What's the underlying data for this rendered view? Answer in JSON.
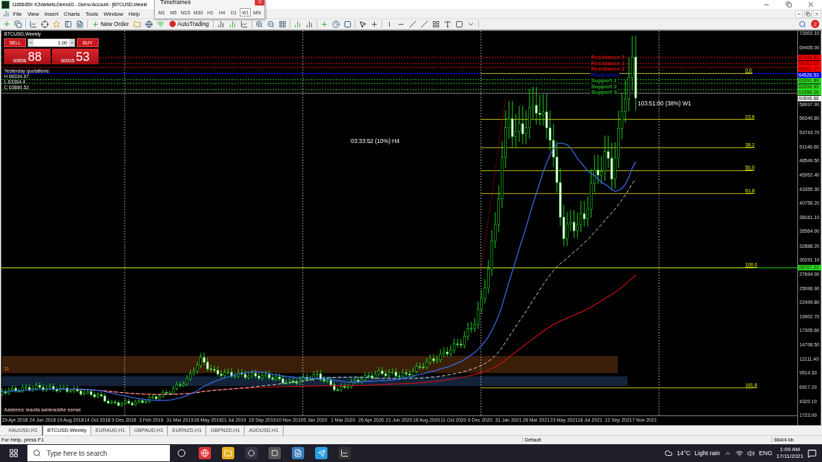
{
  "window": {
    "title": "11656359: ICMarkets-Demo01 - Demo Account - [BTCUSD,Weekl"
  },
  "timeframes_popup": {
    "title": "Timeframes",
    "buttons": [
      {
        "label": "M1",
        "selected": false
      },
      {
        "label": "M5",
        "selected": false
      },
      {
        "label": "M15",
        "selected": false
      },
      {
        "label": "M30",
        "selected": false
      },
      {
        "label": "H1",
        "selected": false
      },
      {
        "label": "H4",
        "selected": false
      },
      {
        "label": "D1",
        "selected": false
      },
      {
        "label": "W1",
        "selected": true
      },
      {
        "label": "MN",
        "selected": false
      }
    ]
  },
  "menu": [
    "File",
    "View",
    "Insert",
    "Charts",
    "Tools",
    "Window",
    "Help"
  ],
  "toolbar": {
    "new_order": "New Order",
    "auto_trading": "AutoTrading",
    "notifications": "2"
  },
  "chart": {
    "title": "BTCUSD,Weekly",
    "trade_panel": {
      "sell": "SELL",
      "buy": "BUY",
      "lot": "1.00",
      "sell_small": "60896",
      "sell_big": "88",
      "buy_small": "60915",
      "buy_big": "53"
    },
    "quotations": [
      "Yesterday quotations:",
      "H 66334.67",
      "L 63364.4",
      "C 63880.52"
    ],
    "pivots": [
      {
        "label": "Resistance 3",
        "color": "#e01010"
      },
      {
        "label": "Resistance 2",
        "color": "#e01010"
      },
      {
        "label": "Resistance 1",
        "color": "#e01010"
      },
      {
        "label": "Pivot level",
        "color": "#1010d0"
      },
      {
        "label": "Support 1",
        "color": "#20b020"
      },
      {
        "label": "Support 2",
        "color": "#20b020"
      },
      {
        "label": "Support 3",
        "color": "#20b020"
      }
    ],
    "fib_levels": [
      "0.0",
      "23.6",
      "38.2",
      "50.0",
      "61.8",
      "100.0",
      "161.8"
    ],
    "timers": [
      "03:33:52 (10%) H4",
      "103:51:00 (38%) W1"
    ],
    "marker_text": "11",
    "footer_text": "Aadeeea: ieaoiia aanieaoiiAe ea¤ae",
    "price_tags": [
      {
        "label": "67496.80",
        "color": "#ff0000"
      },
      {
        "label": "66362.16",
        "color": "#ff0000"
      },
      {
        "label": "65661.17",
        "color": "#ff0000"
      },
      {
        "label": "64526.53",
        "color": "#0000ff"
      },
      {
        "label": "63391.89",
        "color": "#20e020"
      },
      {
        "label": "62690.90",
        "color": "#20e020"
      },
      {
        "label": "61556.26",
        "color": "#20e020"
      },
      {
        "label": "60896.88",
        "color": "#ffffff"
      },
      {
        "label": "28767.23",
        "color": "#20e020"
      }
    ],
    "price_axis": [
      "72002.10",
      "69405.00",
      "58937.90",
      "56340.80",
      "53743.70",
      "51146.60",
      "48549.50",
      "45952.40",
      "43355.30",
      "40758.20",
      "38161.10",
      "35564.00",
      "32888.20",
      "30291.10",
      "27694.00",
      "25096.90",
      "22499.80",
      "19902.70",
      "17305.60",
      "14708.50",
      "12111.40",
      "9514.30",
      "6917.20",
      "4320.10",
      "1723.00"
    ],
    "date_axis": [
      "29 Apr 2018",
      "24 Jun 2018",
      "19 Aug 2018",
      "14 Oct 2018",
      "9 Dec 2018",
      "3 Feb 2019",
      "31 Mar 2019",
      "26 May 2019",
      "21 Jul 2019",
      "15 Sep 2019",
      "10 Nov 2019",
      "5 Jan 2020",
      "1 Mar 2020",
      "26 Apr 2020",
      "21 Jun 2020",
      "16 Aug 2020",
      "11 Oct 2020",
      "6 Dec 2020",
      "31 Jan 2021",
      "28 Mar 2021",
      "23 May 2021",
      "18 Jul 2021",
      "12 Sep 2021",
      "7 Nov 2021"
    ]
  },
  "tabs": [
    {
      "label": "XAUUSD,H1",
      "selected": false
    },
    {
      "label": "BTCUSD,Weekly",
      "selected": true
    },
    {
      "label": "EURAUD,H1",
      "selected": false
    },
    {
      "label": "GBPAUD,H1",
      "selected": false
    },
    {
      "label": "EURNZD,H1",
      "selected": false
    },
    {
      "label": "GBPNZD,H1",
      "selected": false
    },
    {
      "label": "AUDUSD,H1",
      "selected": false
    }
  ],
  "status_bar": {
    "help": "For Help, press F1",
    "profile": "Default",
    "traffic": "664/4 kb"
  },
  "taskbar": {
    "search_placeholder": "Type here to search",
    "temperature": "14°C",
    "weather": "Light rain",
    "language": "ENG",
    "time": "1:09 AM",
    "date": "17/11/2021"
  }
}
